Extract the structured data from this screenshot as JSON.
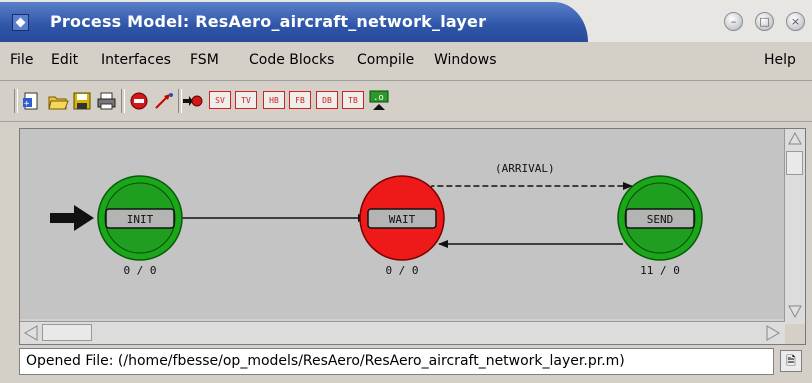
{
  "window": {
    "title": "Process Model: ResAero_aircraft_network_layer",
    "controls": [
      "minimize",
      "maximize",
      "close"
    ]
  },
  "menubar": {
    "items": [
      "File",
      "Edit",
      "Interfaces",
      "FSM",
      "Code Blocks",
      "Compile",
      "Windows"
    ],
    "help": "Help"
  },
  "toolbar": {
    "buttons": [
      {
        "name": "new-icon"
      },
      {
        "name": "open-folder-icon"
      },
      {
        "name": "save-disk-icon"
      },
      {
        "name": "print-icon"
      },
      {
        "name": "stop-icon"
      },
      {
        "name": "create-transition-icon"
      },
      {
        "name": "set-initial-state-icon"
      },
      {
        "name": "sv",
        "label": "SV"
      },
      {
        "name": "tv",
        "label": "TV"
      },
      {
        "name": "hb",
        "label": "HB"
      },
      {
        "name": "fb",
        "label": "FB"
      },
      {
        "name": "db",
        "label": "DB"
      },
      {
        "name": "tb",
        "label": "TB"
      },
      {
        "name": "compile-icon",
        "label": ".o"
      }
    ]
  },
  "fsm": {
    "states": [
      {
        "name": "INIT",
        "counts": "0 / 0",
        "color": "#1aa81a",
        "forced": true,
        "initial": true
      },
      {
        "name": "WAIT",
        "counts": "0 / 0",
        "color": "#ee1a1a",
        "forced": false,
        "initial": false
      },
      {
        "name": "SEND",
        "counts": "11 / 0",
        "color": "#1aa81a",
        "forced": true,
        "initial": false
      }
    ],
    "transitions": [
      {
        "from": "INIT",
        "to": "WAIT",
        "condition": "",
        "style": "solid"
      },
      {
        "from": "WAIT",
        "to": "SEND",
        "condition": "(ARRIVAL)",
        "style": "dashed"
      },
      {
        "from": "SEND",
        "to": "WAIT",
        "condition": "",
        "style": "solid"
      }
    ]
  },
  "statusbar": {
    "text": "Opened File: (/home/fbesse/op_models/ResAero/ResAero_aircraft_network_layer.pr.m)"
  }
}
